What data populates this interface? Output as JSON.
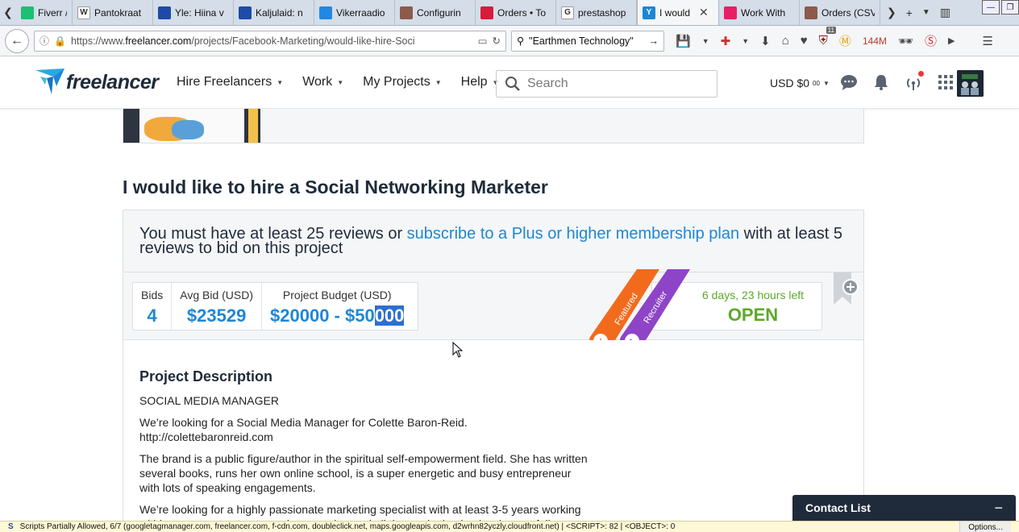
{
  "browser": {
    "tabs": [
      {
        "label": "Fiverr / waf",
        "fav_color": "#1dbf73",
        "fav_text": "",
        "active": false
      },
      {
        "label": "Pantokraat",
        "fav_color": "#ffffff",
        "fav_text": "W",
        "active": false
      },
      {
        "label": "Yle: Hiina v",
        "fav_color": "#1e4aa8",
        "fav_text": "",
        "active": false
      },
      {
        "label": "Kaljulaid: n",
        "fav_color": "#1e4aa8",
        "fav_text": "",
        "active": false
      },
      {
        "label": "Vikerraadio",
        "fav_color": "#1e88e5",
        "fav_text": "",
        "active": false
      },
      {
        "label": "Configurin",
        "fav_color": "#8d5a4a",
        "fav_text": "",
        "active": false
      },
      {
        "label": "Orders • To",
        "fav_color": "#d81b3a",
        "fav_text": "",
        "active": false
      },
      {
        "label": "prestashop",
        "fav_color": "#ffffff",
        "fav_text": "G",
        "active": false
      },
      {
        "label": "I would",
        "fav_color": "#1d87d6",
        "fav_text": "Y",
        "active": true
      },
      {
        "label": "Work With",
        "fav_color": "#e91e63",
        "fav_text": "",
        "active": false
      },
      {
        "label": "Orders (CSV",
        "fav_color": "#8d5a4a",
        "fav_text": "",
        "active": false
      }
    ],
    "url_prefix": "https://www.",
    "url_domain": "freelancer.com",
    "url_path": "/projects/Facebook-Marketing/would-like-hire-Soci",
    "search_query": "\"Earthmen Technology\"",
    "memory": "144M",
    "addon_count": "11",
    "status_text": "Scripts Partially Allowed, 6/7 (googletagmanager.com, freelancer.com, f-cdn.com, doubleclick.net, maps.googleapis.com, d2wrhn82yczly.cloudfront.net) | <SCRIPT>: 82 | <OBJECT>: 0",
    "status_options": "Options..."
  },
  "site": {
    "brand": "freelancer",
    "nav": [
      {
        "label": "Hire Freelancers"
      },
      {
        "label": "Work"
      },
      {
        "label": "My Projects"
      },
      {
        "label": "Help"
      }
    ],
    "search_placeholder": "Search",
    "balance_currency": "USD $0",
    "balance_cents": "00"
  },
  "project": {
    "title": "I would like to hire a Social Networking Marketer",
    "notice_before": "You must have at least 25 reviews or ",
    "notice_link": "subscribe to a Plus or higher membership plan",
    "notice_after": " with at least 5 reviews to bid on this project",
    "stats": {
      "bids_label": "Bids",
      "bids_value": "4",
      "avg_label": "Avg Bid (USD)",
      "avg_value": "$23529",
      "budget_label": "Project Budget (USD)",
      "budget_value_plain": "$20000 - $50",
      "budget_value_selected": "000"
    },
    "time_left": "6 days, 23 hours left",
    "status": "OPEN",
    "ribbon_featured": "Featured",
    "ribbon_recruiter": "Recruiter",
    "featured_color": "#f26b1d",
    "recruiter_color": "#8e44c7",
    "description_title": "Project Description",
    "description": [
      "SOCIAL MEDIA MANAGER",
      "We’re looking for a Social Media Manager for Colette Baron-Reid. http://colettebaronreid.com",
      "The brand is a public figure/author in the spiritual self-empowerment field. She has written several books, runs her own online school, is a super energetic and busy entrepreneur with lots of speaking engagements.",
      "We’re looking for a highly passionate marketing specialist with at least 3-5 years working within a corporate structure where you learned all the marketing basics, have a full"
    ]
  },
  "chat": {
    "title": "Contact List"
  }
}
